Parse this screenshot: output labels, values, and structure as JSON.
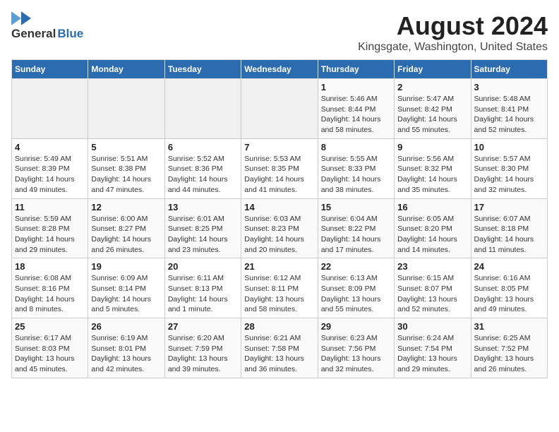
{
  "header": {
    "logo_general": "General",
    "logo_blue": "Blue",
    "title": "August 2024",
    "subtitle": "Kingsgate, Washington, United States"
  },
  "weekdays": [
    "Sunday",
    "Monday",
    "Tuesday",
    "Wednesday",
    "Thursday",
    "Friday",
    "Saturday"
  ],
  "weeks": [
    [
      {
        "day": "",
        "info": ""
      },
      {
        "day": "",
        "info": ""
      },
      {
        "day": "",
        "info": ""
      },
      {
        "day": "",
        "info": ""
      },
      {
        "day": "1",
        "info": "Sunrise: 5:46 AM\nSunset: 8:44 PM\nDaylight: 14 hours\nand 58 minutes."
      },
      {
        "day": "2",
        "info": "Sunrise: 5:47 AM\nSunset: 8:42 PM\nDaylight: 14 hours\nand 55 minutes."
      },
      {
        "day": "3",
        "info": "Sunrise: 5:48 AM\nSunset: 8:41 PM\nDaylight: 14 hours\nand 52 minutes."
      }
    ],
    [
      {
        "day": "4",
        "info": "Sunrise: 5:49 AM\nSunset: 8:39 PM\nDaylight: 14 hours\nand 49 minutes."
      },
      {
        "day": "5",
        "info": "Sunrise: 5:51 AM\nSunset: 8:38 PM\nDaylight: 14 hours\nand 47 minutes."
      },
      {
        "day": "6",
        "info": "Sunrise: 5:52 AM\nSunset: 8:36 PM\nDaylight: 14 hours\nand 44 minutes."
      },
      {
        "day": "7",
        "info": "Sunrise: 5:53 AM\nSunset: 8:35 PM\nDaylight: 14 hours\nand 41 minutes."
      },
      {
        "day": "8",
        "info": "Sunrise: 5:55 AM\nSunset: 8:33 PM\nDaylight: 14 hours\nand 38 minutes."
      },
      {
        "day": "9",
        "info": "Sunrise: 5:56 AM\nSunset: 8:32 PM\nDaylight: 14 hours\nand 35 minutes."
      },
      {
        "day": "10",
        "info": "Sunrise: 5:57 AM\nSunset: 8:30 PM\nDaylight: 14 hours\nand 32 minutes."
      }
    ],
    [
      {
        "day": "11",
        "info": "Sunrise: 5:59 AM\nSunset: 8:28 PM\nDaylight: 14 hours\nand 29 minutes."
      },
      {
        "day": "12",
        "info": "Sunrise: 6:00 AM\nSunset: 8:27 PM\nDaylight: 14 hours\nand 26 minutes."
      },
      {
        "day": "13",
        "info": "Sunrise: 6:01 AM\nSunset: 8:25 PM\nDaylight: 14 hours\nand 23 minutes."
      },
      {
        "day": "14",
        "info": "Sunrise: 6:03 AM\nSunset: 8:23 PM\nDaylight: 14 hours\nand 20 minutes."
      },
      {
        "day": "15",
        "info": "Sunrise: 6:04 AM\nSunset: 8:22 PM\nDaylight: 14 hours\nand 17 minutes."
      },
      {
        "day": "16",
        "info": "Sunrise: 6:05 AM\nSunset: 8:20 PM\nDaylight: 14 hours\nand 14 minutes."
      },
      {
        "day": "17",
        "info": "Sunrise: 6:07 AM\nSunset: 8:18 PM\nDaylight: 14 hours\nand 11 minutes."
      }
    ],
    [
      {
        "day": "18",
        "info": "Sunrise: 6:08 AM\nSunset: 8:16 PM\nDaylight: 14 hours\nand 8 minutes."
      },
      {
        "day": "19",
        "info": "Sunrise: 6:09 AM\nSunset: 8:14 PM\nDaylight: 14 hours\nand 5 minutes."
      },
      {
        "day": "20",
        "info": "Sunrise: 6:11 AM\nSunset: 8:13 PM\nDaylight: 14 hours\nand 1 minute."
      },
      {
        "day": "21",
        "info": "Sunrise: 6:12 AM\nSunset: 8:11 PM\nDaylight: 13 hours\nand 58 minutes."
      },
      {
        "day": "22",
        "info": "Sunrise: 6:13 AM\nSunset: 8:09 PM\nDaylight: 13 hours\nand 55 minutes."
      },
      {
        "day": "23",
        "info": "Sunrise: 6:15 AM\nSunset: 8:07 PM\nDaylight: 13 hours\nand 52 minutes."
      },
      {
        "day": "24",
        "info": "Sunrise: 6:16 AM\nSunset: 8:05 PM\nDaylight: 13 hours\nand 49 minutes."
      }
    ],
    [
      {
        "day": "25",
        "info": "Sunrise: 6:17 AM\nSunset: 8:03 PM\nDaylight: 13 hours\nand 45 minutes."
      },
      {
        "day": "26",
        "info": "Sunrise: 6:19 AM\nSunset: 8:01 PM\nDaylight: 13 hours\nand 42 minutes."
      },
      {
        "day": "27",
        "info": "Sunrise: 6:20 AM\nSunset: 7:59 PM\nDaylight: 13 hours\nand 39 minutes."
      },
      {
        "day": "28",
        "info": "Sunrise: 6:21 AM\nSunset: 7:58 PM\nDaylight: 13 hours\nand 36 minutes."
      },
      {
        "day": "29",
        "info": "Sunrise: 6:23 AM\nSunset: 7:56 PM\nDaylight: 13 hours\nand 32 minutes."
      },
      {
        "day": "30",
        "info": "Sunrise: 6:24 AM\nSunset: 7:54 PM\nDaylight: 13 hours\nand 29 minutes."
      },
      {
        "day": "31",
        "info": "Sunrise: 6:25 AM\nSunset: 7:52 PM\nDaylight: 13 hours\nand 26 minutes."
      }
    ]
  ]
}
